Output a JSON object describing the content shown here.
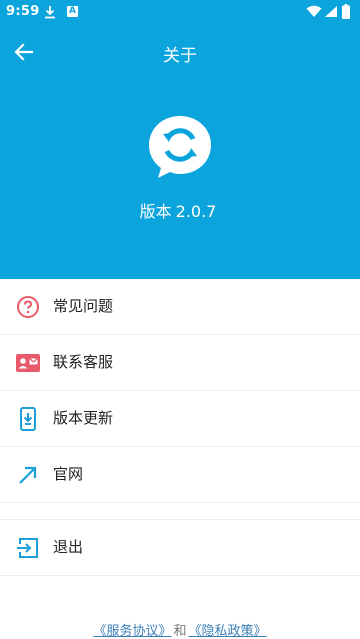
{
  "status_bar": {
    "time": "9:59",
    "notification_letter": "A"
  },
  "app_bar": {
    "title": "关于"
  },
  "hero": {
    "version_prefix": "版本",
    "version_number": "2.0.7"
  },
  "menu": {
    "items": [
      {
        "label": "常见问题",
        "icon": "question-circle-icon"
      },
      {
        "label": "联系客服",
        "icon": "contact-card-icon"
      },
      {
        "label": "版本更新",
        "icon": "phone-download-icon"
      },
      {
        "label": "官网",
        "icon": "arrow-up-right-icon"
      }
    ],
    "logout": {
      "label": "退出",
      "icon": "exit-icon"
    }
  },
  "footer": {
    "terms": "《服务协议》",
    "and": "和",
    "privacy": "《隐私政策》"
  },
  "colors": {
    "primary": "#0ba4dc",
    "accent_red": "#e85a6a",
    "accent_blue": "#1b9fd6"
  }
}
